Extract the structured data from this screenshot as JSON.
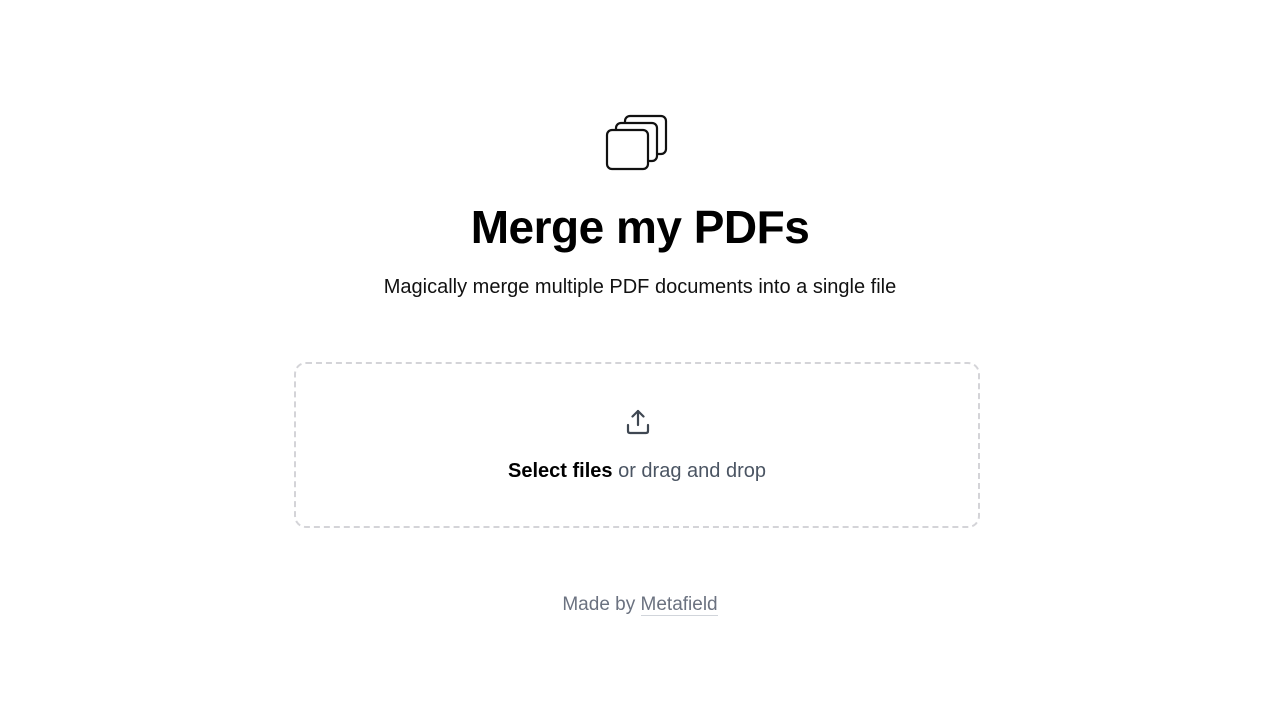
{
  "header": {
    "logo_icon": "stacked-pages-icon",
    "title": "Merge my PDFs",
    "subtitle": "Magically merge multiple PDF documents into a single file"
  },
  "dropzone": {
    "icon": "upload-icon",
    "select_label": "Select files",
    "rest_label": " or drag and drop"
  },
  "footer": {
    "prefix": "Made by ",
    "link_label": "Metafield"
  },
  "colors": {
    "text_primary": "#000000",
    "text_secondary": "#4b5563",
    "text_muted": "#6b7280",
    "dropzone_border": "#d4d4d8",
    "background": "#ffffff"
  }
}
